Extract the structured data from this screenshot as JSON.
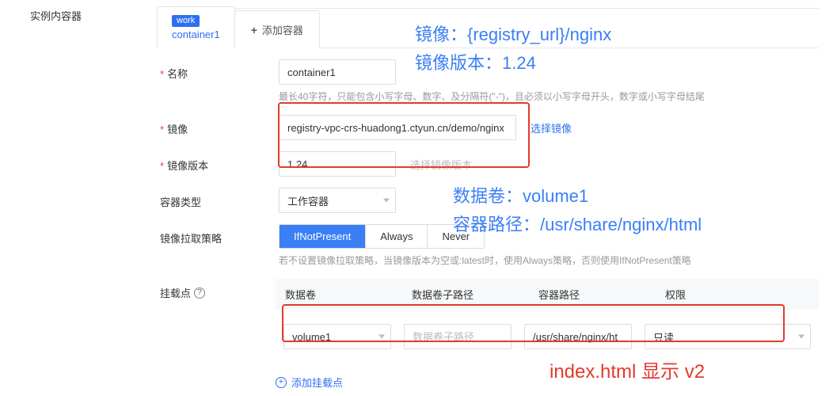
{
  "side_label": "实例内容器",
  "tabs": {
    "active_badge": "work",
    "active_title": "container1",
    "add_label": "添加容器"
  },
  "fields": {
    "name": {
      "label": "名称",
      "value": "container1",
      "hint": "最长40字符，只能包含小写字母、数字、及分隔符(\"-\")，且必须以小写字母开头，数字或小写字母结尾"
    },
    "image": {
      "label": "镜像",
      "value": "registry-vpc-crs-huadong1.ctyun.cn/demo/nginx",
      "choose": "选择镜像"
    },
    "imageVersion": {
      "label": "镜像版本",
      "value": "1.24",
      "choose_placeholder": "选择镜像版本"
    },
    "containerType": {
      "label": "容器类型",
      "value": "工作容器"
    },
    "pullPolicy": {
      "label": "镜像拉取策略",
      "options": [
        "IfNotPresent",
        "Always",
        "Never"
      ],
      "active": "IfNotPresent",
      "hint": "若不设置镜像拉取策略，当镜像版本为空或:latest时，使用Always策略，否则使用IfNotPresent策略"
    },
    "mount": {
      "label": "挂载点",
      "headers": {
        "vol": "数据卷",
        "sub": "数据卷子路径",
        "path": "容器路径",
        "perm": "权限"
      },
      "row": {
        "vol": "volume1",
        "sub_placeholder": "数据卷子路径",
        "path": "/usr/share/nginx/ht",
        "perm": "只读"
      },
      "add": "添加挂载点"
    }
  },
  "annotations": {
    "a1": "镜像：{registry_url}/nginx",
    "a2": "镜像版本：1.24",
    "a3": "数据卷：volume1",
    "a4": "容器路径：/usr/share/nginx/html",
    "a5": "index.html 显示 v2"
  }
}
